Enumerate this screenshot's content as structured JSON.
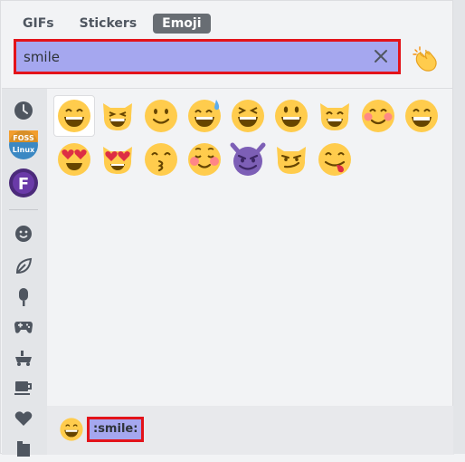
{
  "tabs": [
    {
      "label": "GIFs",
      "active": false
    },
    {
      "label": "Stickers",
      "active": false
    },
    {
      "label": "Emoji",
      "active": true
    }
  ],
  "search": {
    "value": "smile",
    "clear_icon": "close-icon"
  },
  "skin_tone_icon": "clapping-hands-icon",
  "sidebar": {
    "recent_icon": "clock-icon",
    "servers": [
      {
        "name": "FOSS Linux",
        "label_top": "FOSS",
        "label_bottom": "Linux",
        "color": "#3b88c3"
      },
      {
        "name": "F",
        "label_top": "F",
        "label_bottom": "",
        "color": "#4b2a7a"
      }
    ],
    "categories": [
      "smiley-face-icon",
      "leaf-icon",
      "popsicle-icon",
      "gamepad-icon",
      "car-icon",
      "coffee-icon",
      "heart-icon",
      "building-icon"
    ]
  },
  "emoji_results": [
    "grinning-smiling-eyes",
    "grinning-cat-squinting",
    "slightly-smiling",
    "grinning-sweat",
    "grinning-squinting",
    "grinning-big-eyes",
    "grinning-cat",
    "smiling-blushing",
    "grin",
    "heart-eyes",
    "heart-eyes-cat",
    "kissing-smiling-eyes",
    "relaxed-blush",
    "smiling-imp",
    "smirk-cat",
    "yum"
  ],
  "footer": {
    "preview_name": "grinning-smiling-eyes",
    "shortcode": ":smile:"
  },
  "colors": {
    "highlight": "#a5a7ef",
    "outline": "#e3131a",
    "emoji_yellow": "#ffcc4d",
    "emoji_purple": "#7d5fb6"
  }
}
